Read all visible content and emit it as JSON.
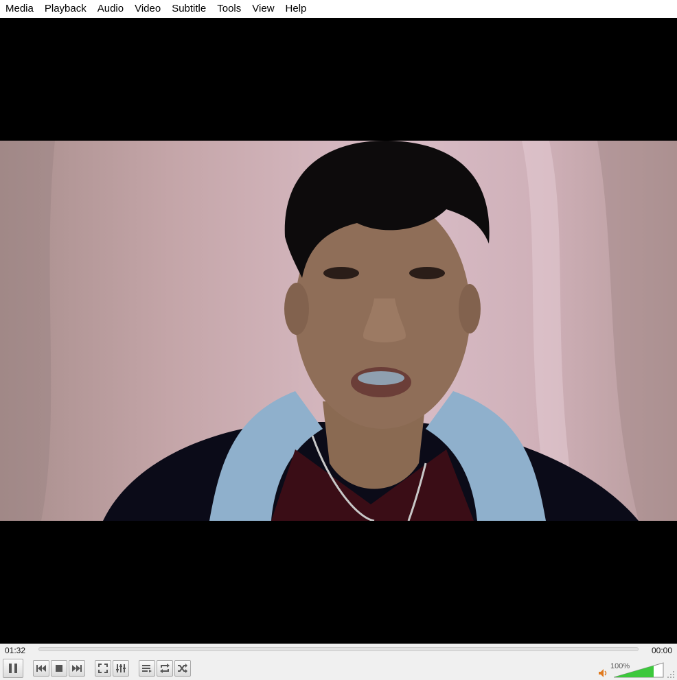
{
  "menu": {
    "items": [
      "Media",
      "Playback",
      "Audio",
      "Video",
      "Subtitle",
      "Tools",
      "View",
      "Help"
    ]
  },
  "seek": {
    "elapsed": "01:32",
    "total": "00:00",
    "progress": 0
  },
  "volume": {
    "label": "100%",
    "level": 1.0
  },
  "icons": {
    "pause": "pause-icon",
    "previous": "previous-icon",
    "stop": "stop-icon",
    "next": "next-icon",
    "fullscreen": "fullscreen-icon",
    "extended_settings": "extended-settings-icon",
    "playlist": "playlist-icon",
    "loop": "loop-icon",
    "random": "random-icon",
    "speaker": "speaker-icon"
  },
  "colors": {
    "volume_fill": "#3cc83c",
    "speaker": "#e07a1f",
    "video_background": "#000000"
  }
}
